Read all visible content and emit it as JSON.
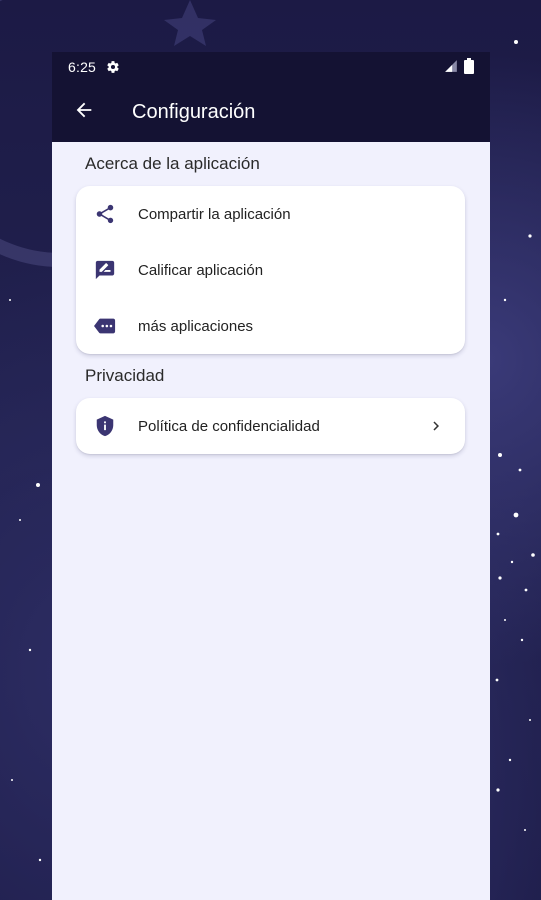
{
  "status_bar": {
    "time": "6:25"
  },
  "app_bar": {
    "title": "Configuración"
  },
  "sections": {
    "about": {
      "header": "Acerca de la aplicación",
      "items": [
        {
          "label": "Compartir la aplicación",
          "icon": "share-icon"
        },
        {
          "label": "Calificar aplicación",
          "icon": "rate-review-icon"
        },
        {
          "label": "más aplicaciones",
          "icon": "more-apps-icon"
        }
      ]
    },
    "privacy": {
      "header": "Privacidad",
      "items": [
        {
          "label": "Política de confidencialidad",
          "icon": "shield-icon"
        }
      ]
    }
  },
  "colors": {
    "accent": "#3b3572",
    "app_bar": "#141233",
    "content_background": "#f1f1fd"
  }
}
